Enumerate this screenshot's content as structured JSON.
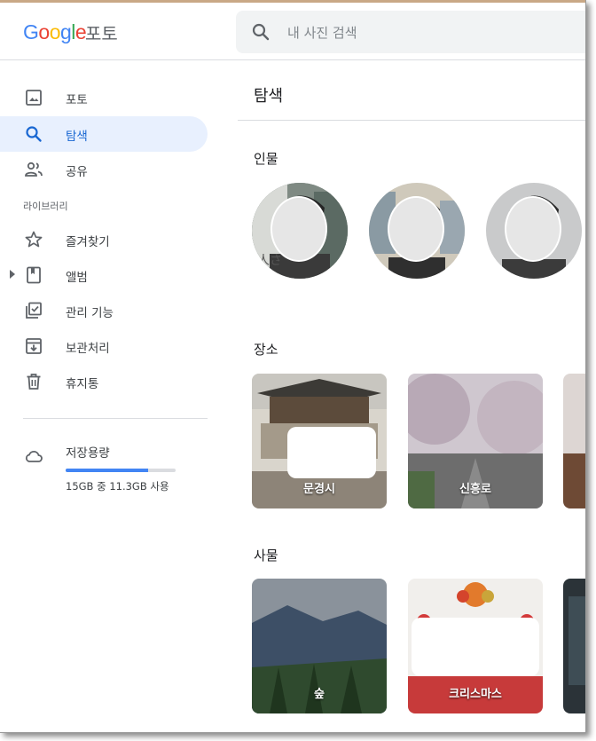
{
  "header": {
    "logo_letters": [
      "G",
      "o",
      "o",
      "g",
      "l",
      "e"
    ],
    "logo_colors": [
      "#4285f4",
      "#ea4335",
      "#fbbc05",
      "#4285f4",
      "#34a853",
      "#ea4335"
    ],
    "product_name": "포토",
    "search_placeholder": "내 사진 검색"
  },
  "sidebar": {
    "items": [
      {
        "label": "포토",
        "icon": "photo-icon",
        "active": false
      },
      {
        "label": "탐색",
        "icon": "search-icon",
        "active": true
      },
      {
        "label": "공유",
        "icon": "people-icon",
        "active": false
      }
    ],
    "library_label": "라이브러리",
    "library_items": [
      {
        "label": "즐겨찾기",
        "icon": "star-icon"
      },
      {
        "label": "앨범",
        "icon": "album-icon"
      },
      {
        "label": "관리 기능",
        "icon": "utilities-icon"
      },
      {
        "label": "보관처리",
        "icon": "archive-icon"
      },
      {
        "label": "휴지통",
        "icon": "trash-icon"
      }
    ],
    "storage": {
      "title": "저장용량",
      "detail": "15GB 중 11.3GB 사용",
      "used_fraction": 0.75
    }
  },
  "main": {
    "title": "탐색",
    "sections": {
      "people": {
        "title": "인물"
      },
      "places": {
        "title": "장소",
        "items": [
          "문경시",
          "신흥로"
        ]
      },
      "things": {
        "title": "사물",
        "items": [
          "숲",
          "크리스마스"
        ]
      }
    }
  },
  "colors": {
    "accent": "#1967d2",
    "active_bg": "#e8f0fe",
    "storage_bar": "#4285f4"
  }
}
